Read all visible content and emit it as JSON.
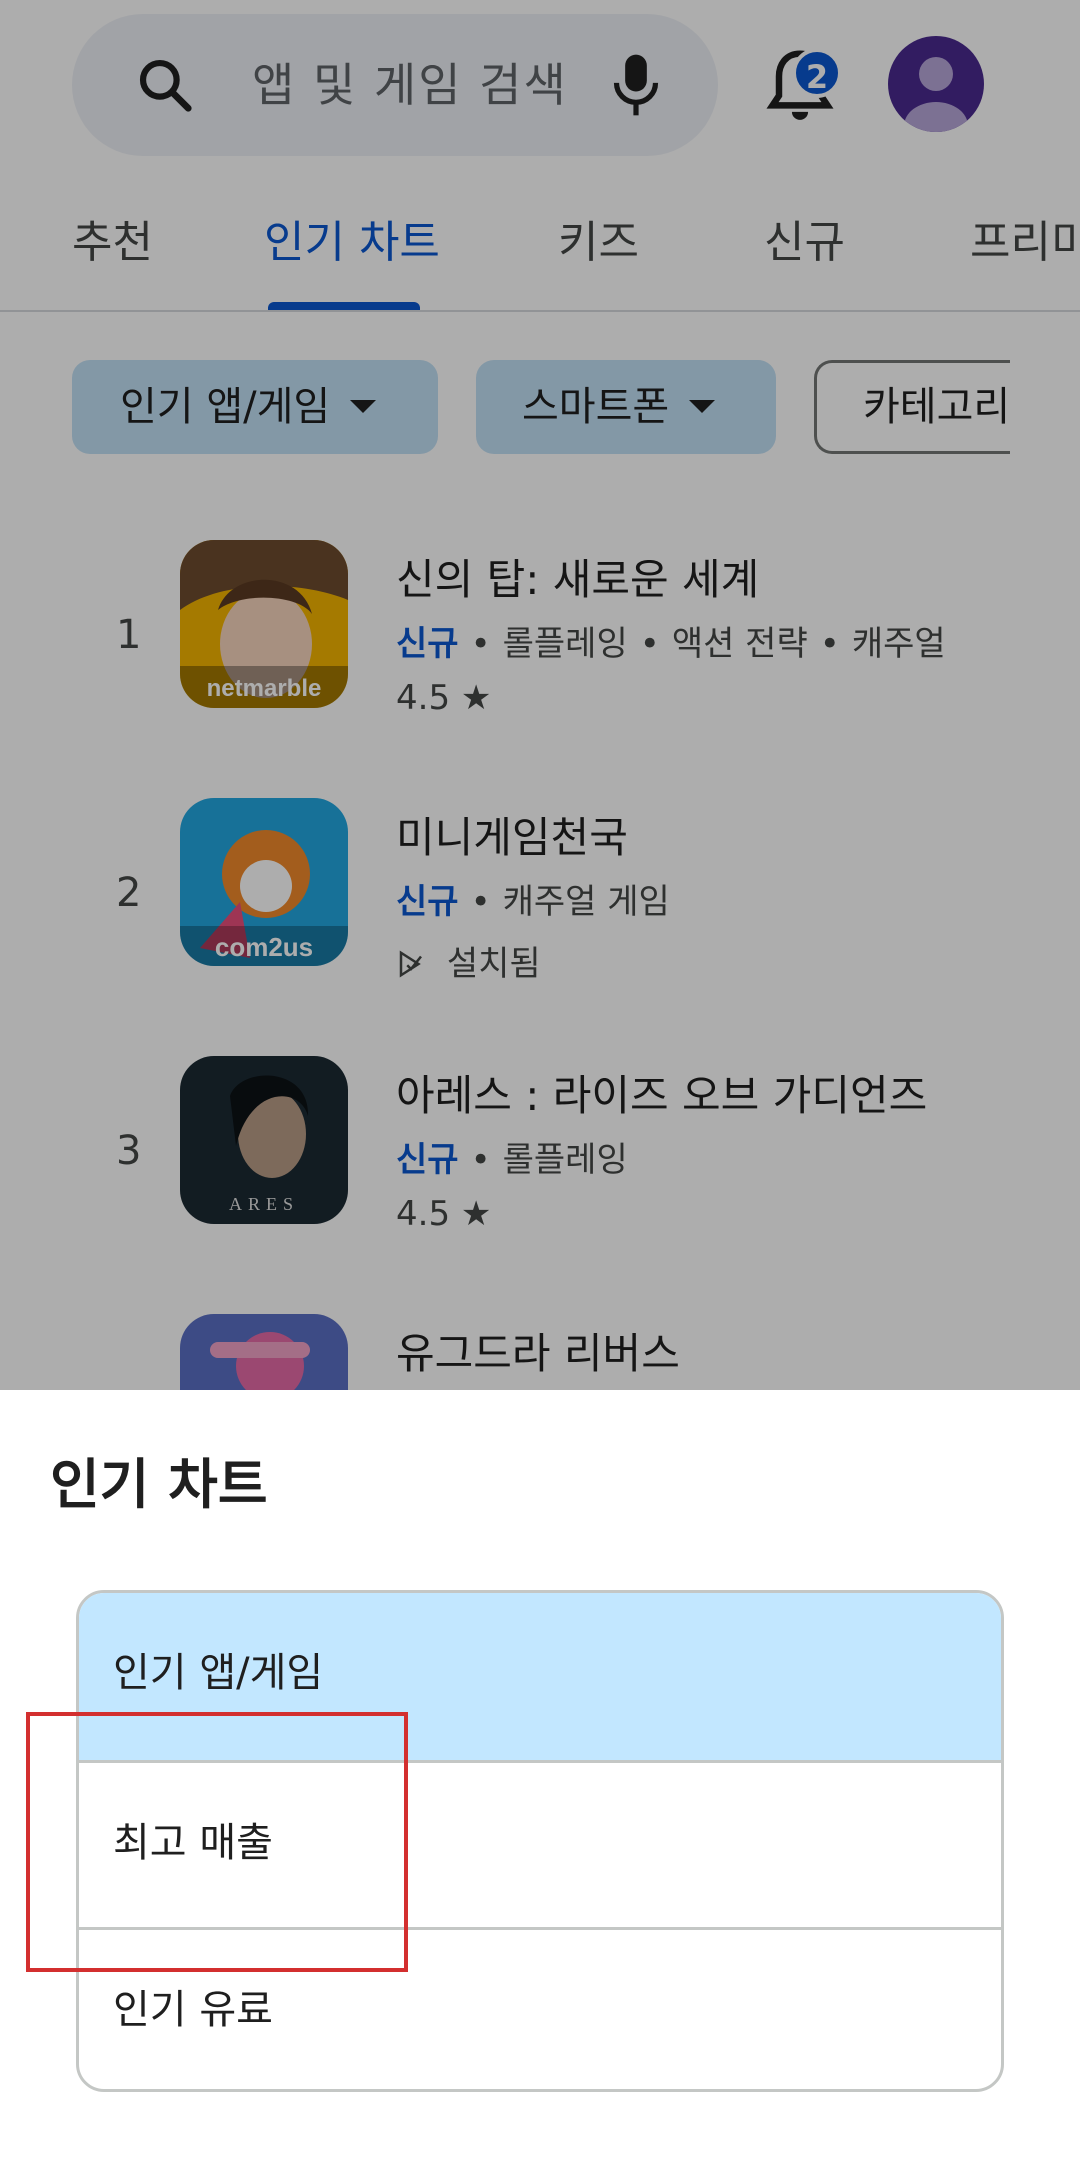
{
  "search": {
    "placeholder": "앱 및 게임 검색"
  },
  "notifications": {
    "count": "2"
  },
  "tabs": [
    {
      "label": "추천"
    },
    {
      "label": "인기 차트"
    },
    {
      "label": "키즈"
    },
    {
      "label": "신규"
    },
    {
      "label": "프리미"
    }
  ],
  "chips": [
    {
      "label": "인기 앱/게임"
    },
    {
      "label": "스마트폰"
    },
    {
      "label": "카테고리"
    }
  ],
  "apps": [
    {
      "rank": "1",
      "title": "신의 탑: 새로운 세계",
      "tag": "신규",
      "categories": [
        "롤플레잉",
        "액션 전략",
        "캐주얼"
      ],
      "rating": "4.5",
      "icon_label": "netmarble"
    },
    {
      "rank": "2",
      "title": "미니게임천국",
      "tag": "신규",
      "categories": [
        "캐주얼 게임"
      ],
      "status": "설치됨",
      "icon_label": "com2us"
    },
    {
      "rank": "3",
      "title": "아레스 : 라이즈 오브 가디언즈",
      "tag": "신규",
      "categories": [
        "롤플레잉"
      ],
      "rating": "4.5",
      "icon_label": "ARES"
    },
    {
      "rank": "",
      "title": "유그드라 리버스"
    }
  ],
  "sheet": {
    "title": "인기 차트",
    "options": [
      {
        "label": "인기 앱/게임",
        "selected": true
      },
      {
        "label": "최고 매출",
        "selected": false
      },
      {
        "label": "인기 유료",
        "selected": false
      }
    ]
  },
  "colors": {
    "accent": "#0b57d0",
    "selected_bg": "#c2e7ff",
    "highlight": "#d32f2f"
  }
}
